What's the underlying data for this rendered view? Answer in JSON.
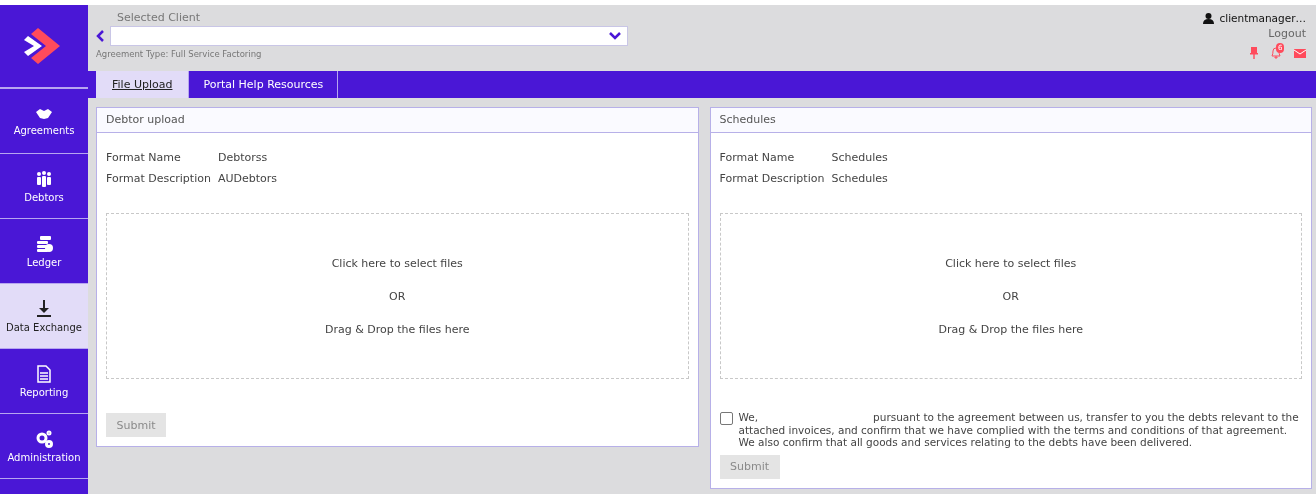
{
  "sidebar": {
    "items": [
      {
        "label": "Agreements",
        "selected": false
      },
      {
        "label": "Debtors",
        "selected": false
      },
      {
        "label": "Ledger",
        "selected": false
      },
      {
        "label": "Data Exchange",
        "selected": true
      },
      {
        "label": "Reporting",
        "selected": false
      },
      {
        "label": "Administration",
        "selected": false
      }
    ]
  },
  "header": {
    "client_label": "Selected Client",
    "agreement_type": "Agreement Type: Full Service Factoring",
    "user": "clientmanager…",
    "logout": "Logout",
    "notification_count": "6"
  },
  "tabs": [
    {
      "label": "File Upload",
      "selected": true
    },
    {
      "label": "Portal Help Resources",
      "selected": false
    }
  ],
  "panels": [
    {
      "title": "Debtor upload",
      "format_name_label": "Format Name",
      "format_name": "Debtorss",
      "format_description_label": "Format Description",
      "format_description": "AUDebtors",
      "drop_lines": [
        "Click here to select files",
        "OR",
        "Drag & Drop the files here"
      ],
      "submit": "Submit"
    },
    {
      "title": "Schedules",
      "format_name_label": "Format Name",
      "format_name": "Schedules",
      "format_description_label": "Format Description",
      "format_description": "Schedules",
      "drop_lines": [
        "Click here to select files",
        "OR",
        "Drag & Drop the files here"
      ],
      "declaration": {
        "checked": false,
        "lead": "We,",
        "text": "pursuant to the agreement between us, transfer to you the debts relevant to the attached invoices, and confirm that we have complied with the terms and conditions of that agreement. We also confirm that all goods and services relating to the debts have been delivered."
      },
      "submit": "Submit"
    }
  ]
}
